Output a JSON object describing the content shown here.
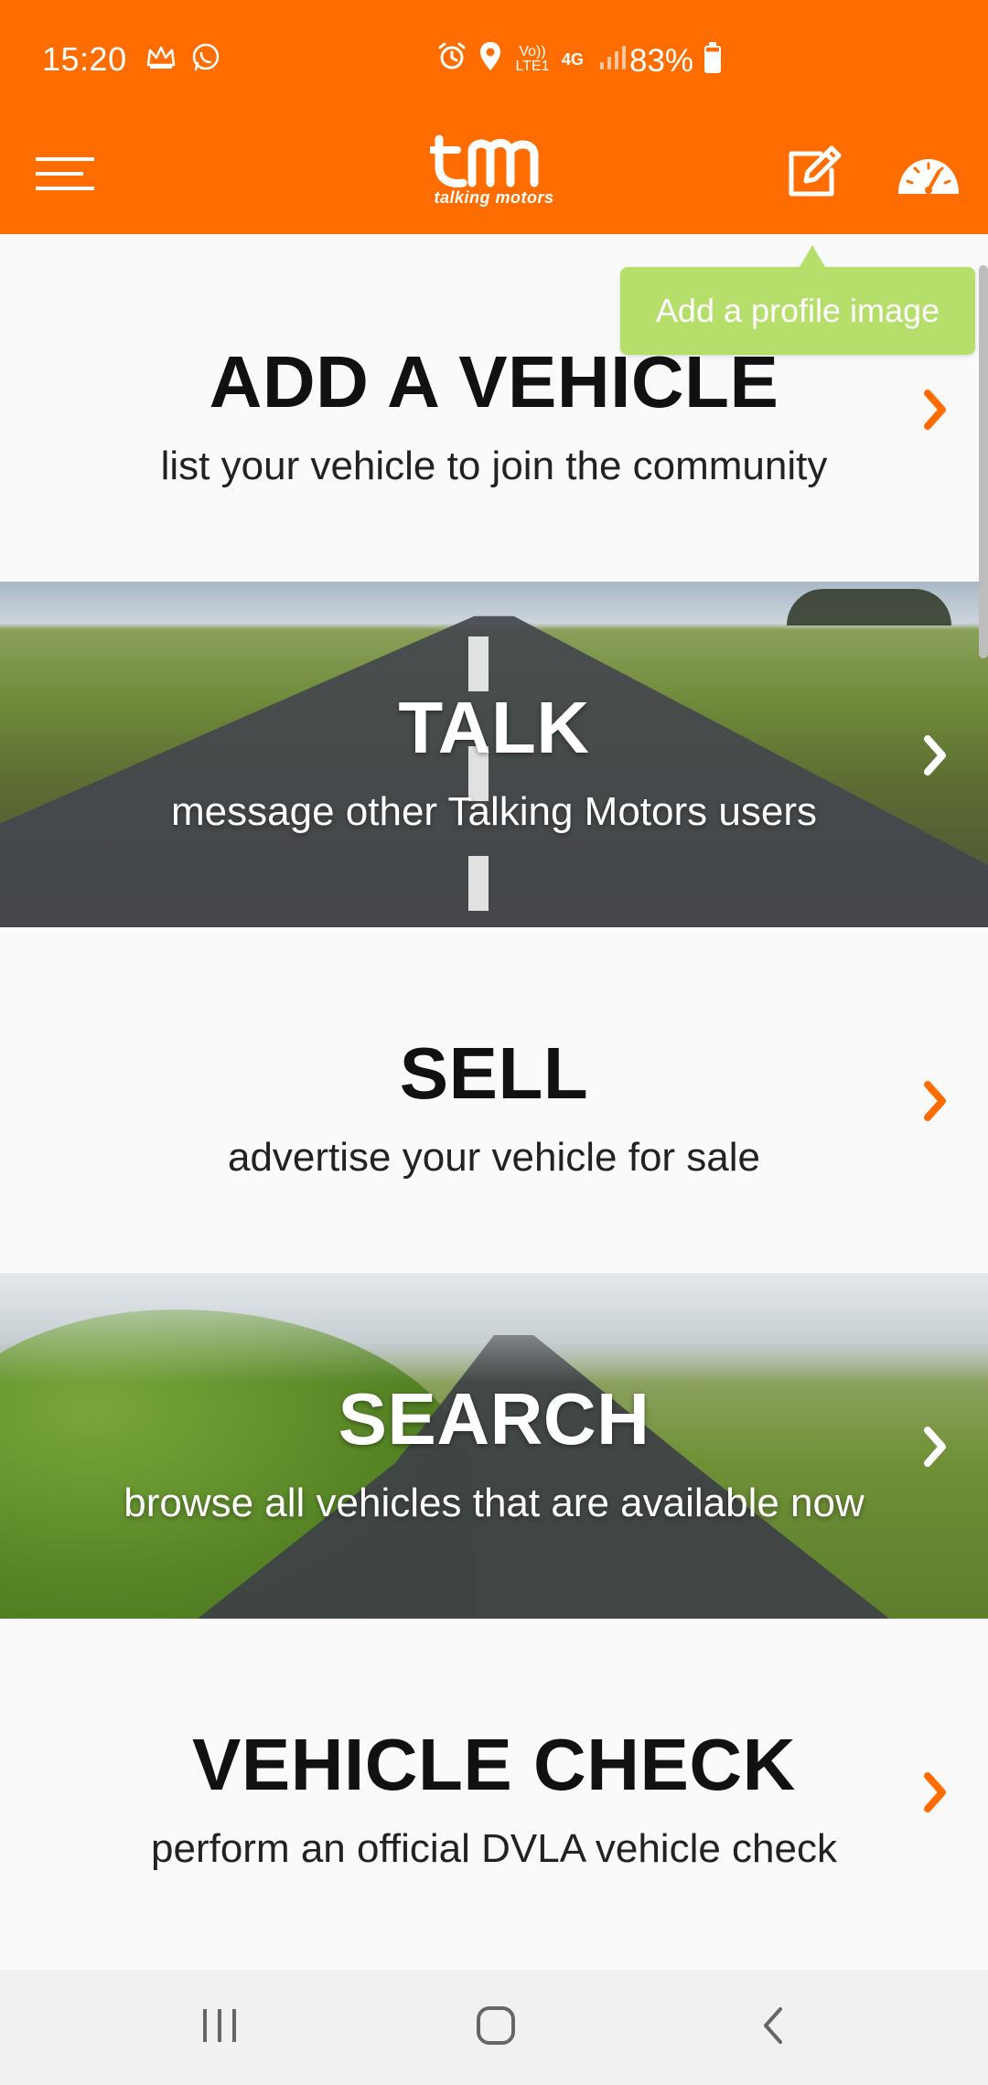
{
  "status_bar": {
    "time": "15:20",
    "battery": "83%",
    "network": "4G",
    "volte": "Vo)) LTE1"
  },
  "header": {
    "logo_text": "tm",
    "logo_subtext": "talking motors"
  },
  "tooltip": {
    "text": "Add a profile image"
  },
  "cards": [
    {
      "title": "ADD A VEHICLE",
      "subtitle": "list your vehicle to join the community"
    },
    {
      "title": "TALK",
      "subtitle": "message other Talking Motors users"
    },
    {
      "title": "SELL",
      "subtitle": "advertise your vehicle for sale"
    },
    {
      "title": "SEARCH",
      "subtitle": "browse all vehicles that are available now"
    },
    {
      "title": "VEHICLE CHECK",
      "subtitle": "perform an official DVLA vehicle check"
    }
  ],
  "colors": {
    "brand_orange": "#ff6d00",
    "tooltip_green": "#b5df6a",
    "chevron_orange": "#ff6d00"
  },
  "icons": {
    "menu": "hamburger-menu-icon",
    "edit": "edit-icon",
    "speedometer": "speedometer-icon",
    "chevron": "chevron-right-icon"
  }
}
